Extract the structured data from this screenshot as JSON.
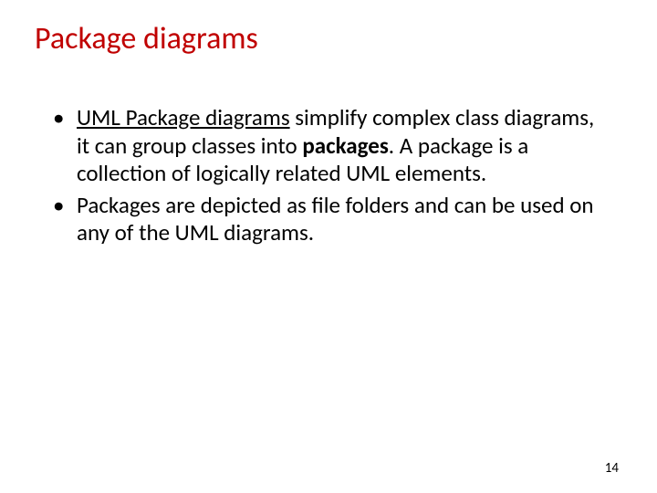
{
  "slide": {
    "title": "Package diagrams",
    "bullets": [
      {
        "link_text": "UML Package diagrams",
        "mid1": " simplify complex class diagrams, it can group classes into ",
        "bold1": "packages",
        "mid2": ". A package is a collection of logically related UML elements."
      },
      {
        "text": "Packages are depicted as file folders and can be used on any of the UML diagrams."
      }
    ],
    "page_number": "14"
  }
}
